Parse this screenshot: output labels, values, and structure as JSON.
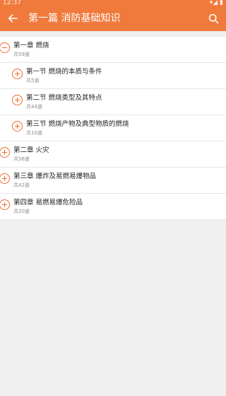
{
  "status": {
    "time": "12:37",
    "right": "▾◢ ▮"
  },
  "header": {
    "title": "第一篇 消防基础知识",
    "back_icon": "back-arrow-icon",
    "search_icon": "search-icon"
  },
  "items": [
    {
      "level": "chapter",
      "expanded": true,
      "name": "第一章 燃烧",
      "count": "共59道"
    },
    {
      "level": "section",
      "expanded": false,
      "name": "第一节 燃烧的本质与条件",
      "count": "共5道"
    },
    {
      "level": "section",
      "expanded": false,
      "name": "第二节 燃烧类型及其特点",
      "count": "共44道"
    },
    {
      "level": "section",
      "expanded": false,
      "name": "第三节 燃烧产物及典型物质的燃烧",
      "count": "共10道"
    },
    {
      "level": "chapter",
      "expanded": false,
      "name": "第二章 火灾",
      "count": "共56道"
    },
    {
      "level": "chapter",
      "expanded": false,
      "name": "第三章 爆炸及易燃易爆物品",
      "count": "共42道"
    },
    {
      "level": "chapter",
      "expanded": false,
      "name": "第四章 易燃易爆危险品",
      "count": "共20道"
    }
  ],
  "colors": {
    "accent": "#f07a3c",
    "icon": "#ef6a2c",
    "background": "#efefef"
  }
}
